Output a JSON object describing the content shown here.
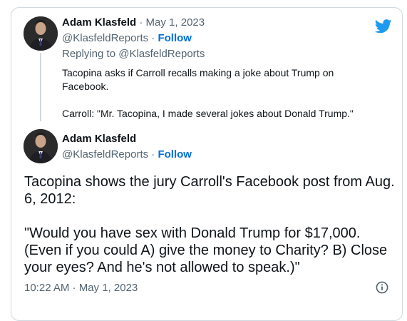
{
  "tweet1": {
    "name": "Adam Klasfeld",
    "date": "May 1, 2023",
    "handle": "@KlasfeldReports",
    "follow_label": "Follow",
    "reply_prefix": "Replying to ",
    "reply_to": "@KlasfeldReports",
    "text_p1": "Tacopina asks if Carroll recalls making a joke about Trump on Facebook.",
    "text_p2": "Carroll: \"Mr. Tacopina, I made several jokes about Donald Trump.\""
  },
  "tweet2": {
    "name": "Adam Klasfeld",
    "handle": "@KlasfeldReports",
    "follow_label": "Follow",
    "text_p1": "Tacopina shows the jury Carroll's Facebook post from Aug. 6, 2012:",
    "text_p2": "\"Would you have sex with Donald Trump for $17,000. (Even if you could A) give the money to Charity? B) Close your eyes? And he's not allowed to speak.)\"",
    "timestamp": "10:22 AM · May 1, 2023"
  },
  "icons": {
    "brand": "twitter-bird-icon",
    "info": "info-icon"
  },
  "colors": {
    "brand_blue": "#1d9bf0",
    "link_blue": "#006fd6",
    "muted": "#536471",
    "text": "#0f1419",
    "border": "#cfd9de"
  }
}
